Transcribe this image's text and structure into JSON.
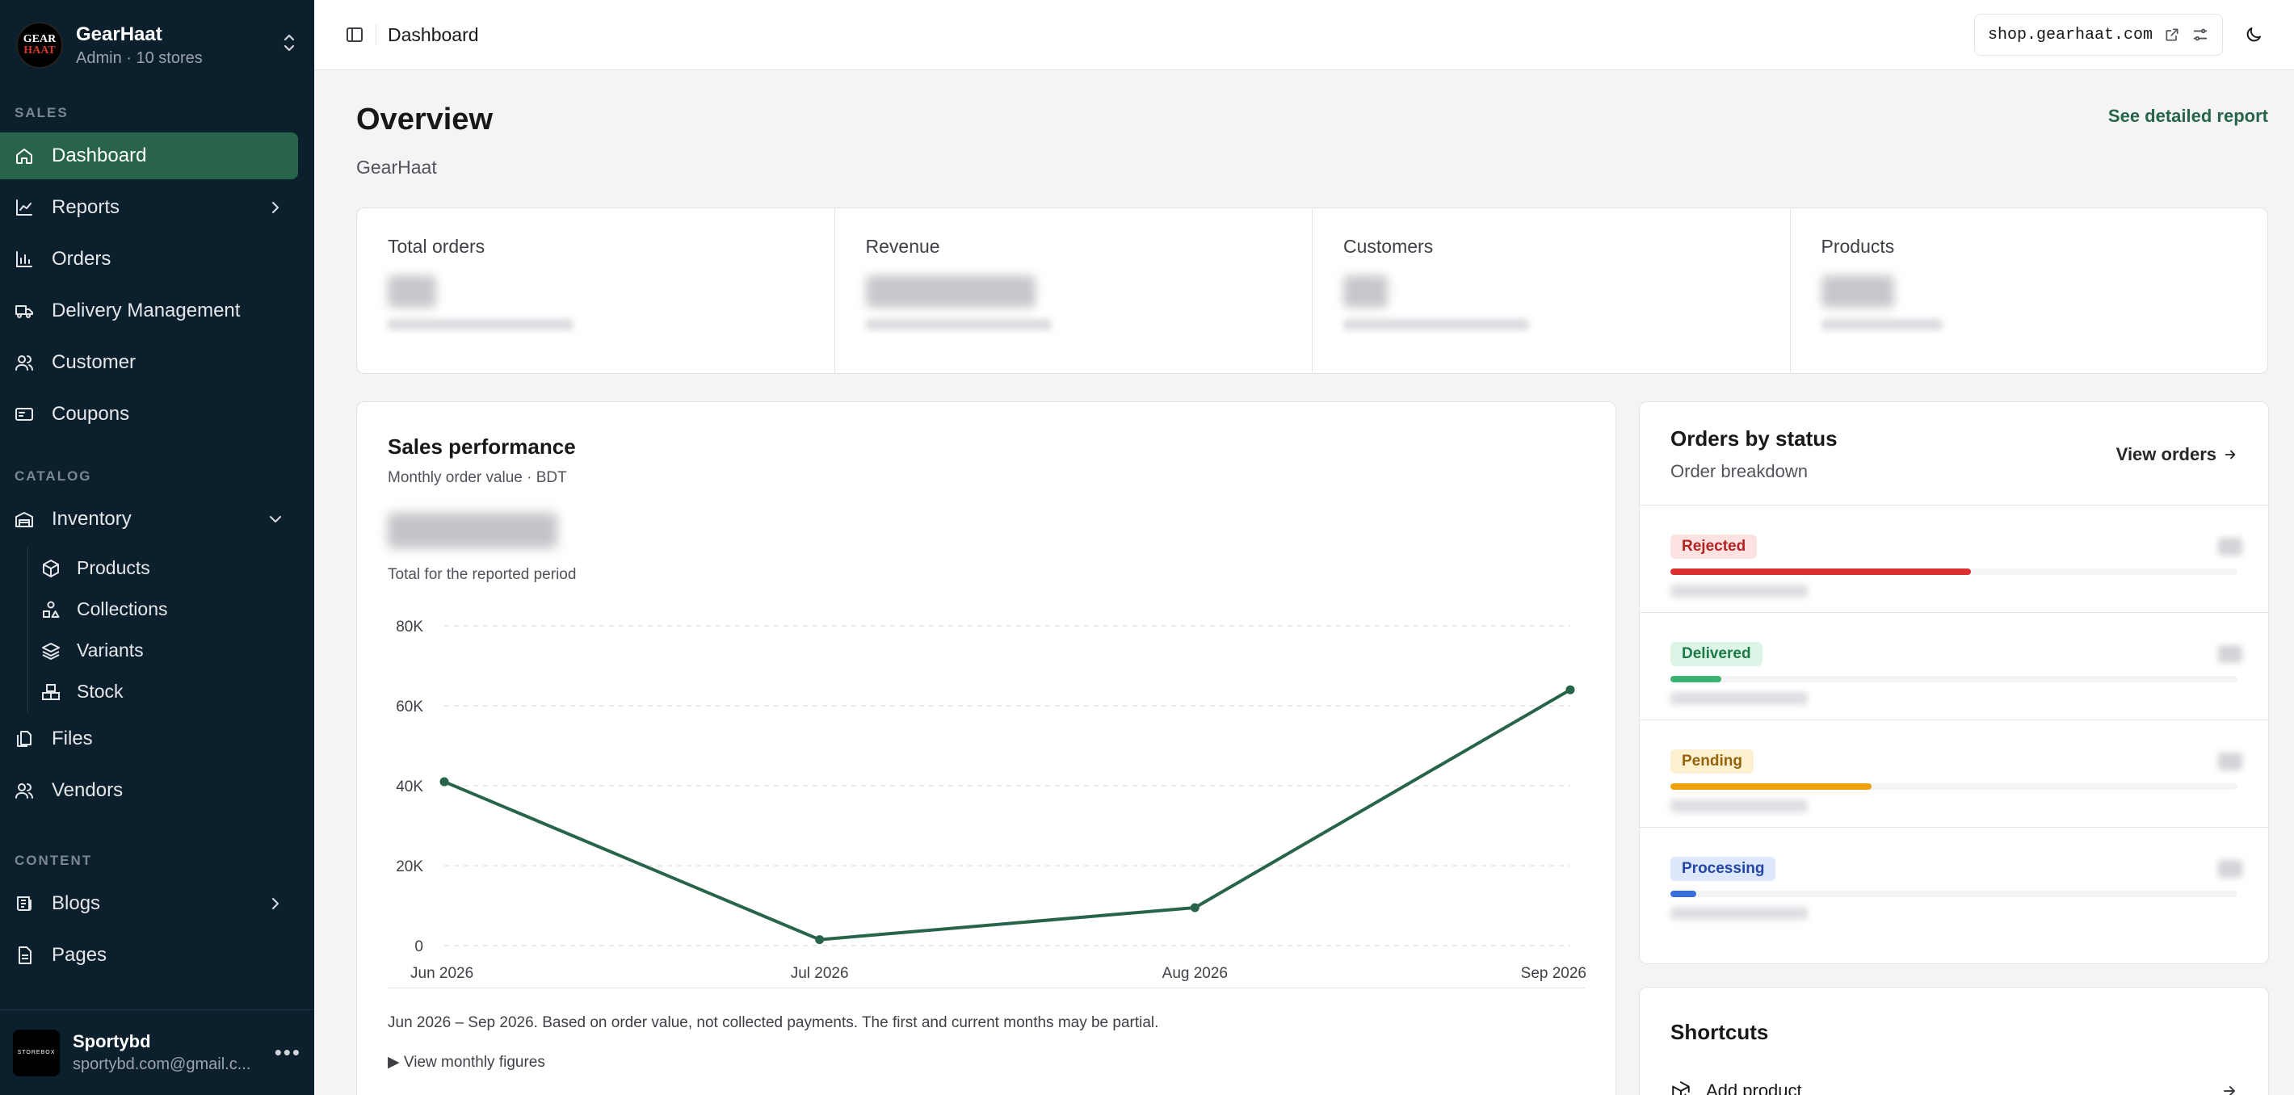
{
  "org": {
    "logo_line1": "GEAR",
    "logo_line2": "HAAT",
    "name": "GearHaat",
    "subtitle": "Admin · 10 stores"
  },
  "sidebar": {
    "sections": {
      "sales": "SALES",
      "catalog": "CATALOG",
      "content": "CONTENT"
    },
    "items": {
      "dashboard": "Dashboard",
      "reports": "Reports",
      "orders": "Orders",
      "delivery": "Delivery Management",
      "customer": "Customer",
      "coupons": "Coupons",
      "inventory": "Inventory",
      "products": "Products",
      "collections": "Collections",
      "variants": "Variants",
      "stock": "Stock",
      "files": "Files",
      "vendors": "Vendors",
      "blogs": "Blogs",
      "pages": "Pages"
    },
    "user": {
      "avatar_text": "STOREBOX",
      "name": "Sportybd",
      "email": "sportybd.com@gmail.c..."
    }
  },
  "topbar": {
    "title": "Dashboard",
    "url": "shop.gearhaat.com"
  },
  "overview": {
    "title": "Overview",
    "subtitle": "GearHaat",
    "report_link": "See detailed report"
  },
  "stats": [
    {
      "label": "Total orders"
    },
    {
      "label": "Revenue"
    },
    {
      "label": "Customers"
    },
    {
      "label": "Products"
    }
  ],
  "sales": {
    "title": "Sales performance",
    "subtitle": "Monthly order value · BDT",
    "total_label": "Total for the reported period",
    "footnote": "Jun 2026 – Sep 2026. Based on order value, not collected payments. The first and current months may be partial.",
    "view_figures": "▶ View monthly figures"
  },
  "chart_data": {
    "type": "line",
    "x": [
      "Jun 2026",
      "Jul 2026",
      "Aug 2026",
      "Sep 2026"
    ],
    "y_ticks": [
      "0",
      "20K",
      "40K",
      "60K",
      "80K"
    ],
    "ylim": [
      0,
      80000
    ],
    "series": [
      {
        "values": [
          41000,
          1500,
          9500,
          64000
        ]
      }
    ],
    "grid": true,
    "color": "#27644a"
  },
  "orders_status": {
    "title": "Orders by status",
    "subtitle": "Order breakdown",
    "view_link": "View orders",
    "rows": [
      {
        "label": "Rejected",
        "fraction": 0.53,
        "color": "#dc2f2f",
        "badge_bg": "#fde2e2",
        "badge_fg": "#b42323"
      },
      {
        "label": "Delivered",
        "fraction": 0.09,
        "color": "#3bb273",
        "badge_bg": "#dcf5e6",
        "badge_fg": "#1c7a47"
      },
      {
        "label": "Pending",
        "fraction": 0.355,
        "color": "#f0a00c",
        "badge_bg": "#fdf1cf",
        "badge_fg": "#93620a"
      },
      {
        "label": "Processing",
        "fraction": 0.045,
        "color": "#3b6fe0",
        "badge_bg": "#dde8fc",
        "badge_fg": "#2447a3"
      }
    ]
  },
  "shortcuts": {
    "title": "Shortcuts",
    "items": [
      "Add product"
    ]
  }
}
